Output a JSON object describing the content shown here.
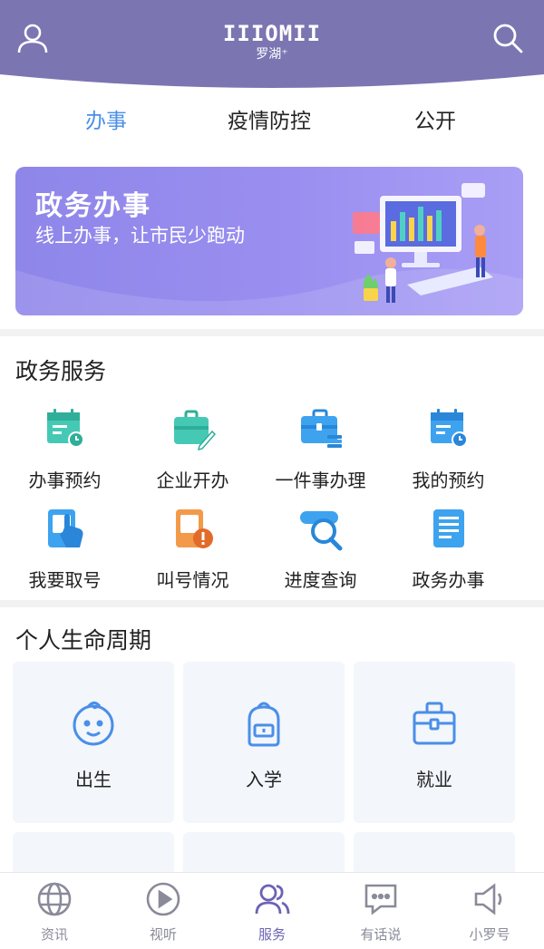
{
  "colors": {
    "header": "#7b75b2",
    "accent": "#4a8fe8",
    "nav_active": "#6b63b5",
    "banner": "#9a8ff0"
  },
  "header": {
    "logo_mark": "IIIOMII",
    "logo_sub": "罗湖⁺",
    "user_icon": "user-icon",
    "search_icon": "search-icon"
  },
  "tabs": [
    {
      "label": "办事",
      "active": true
    },
    {
      "label": "疫情防控"
    },
    {
      "label": "公开"
    }
  ],
  "banner": {
    "title": "政务办事",
    "subtitle": "线上办事，让市民少跑动"
  },
  "gov_services": {
    "title": "政务服务",
    "items": [
      {
        "label": "办事预约",
        "icon": "calendar-clock-icon"
      },
      {
        "label": "企业开办",
        "icon": "briefcase-pen-icon"
      },
      {
        "label": "一件事办理",
        "icon": "toolbox-icon"
      },
      {
        "label": "我的预约",
        "icon": "calendar-clock-icon"
      },
      {
        "label": "我要取号",
        "icon": "ticket-hand-icon"
      },
      {
        "label": "叫号情况",
        "icon": "ticket-alert-icon"
      },
      {
        "label": "进度查询",
        "icon": "search-progress-icon"
      },
      {
        "label": "政务办事",
        "icon": "document-list-icon"
      }
    ]
  },
  "life_cycle": {
    "title": "个人生命周期",
    "cards": [
      {
        "label": "出生",
        "icon": "baby-icon"
      },
      {
        "label": "入学",
        "icon": "schoolbag-icon"
      },
      {
        "label": "就业",
        "icon": "briefcase-icon"
      }
    ]
  },
  "bottom_nav": [
    {
      "label": "资讯",
      "icon": "globe-icon"
    },
    {
      "label": "视听",
      "icon": "play-icon"
    },
    {
      "label": "服务",
      "icon": "people-icon",
      "active": true
    },
    {
      "label": "有话说",
      "icon": "chat-icon"
    },
    {
      "label": "小罗号",
      "icon": "speaker-icon"
    }
  ]
}
